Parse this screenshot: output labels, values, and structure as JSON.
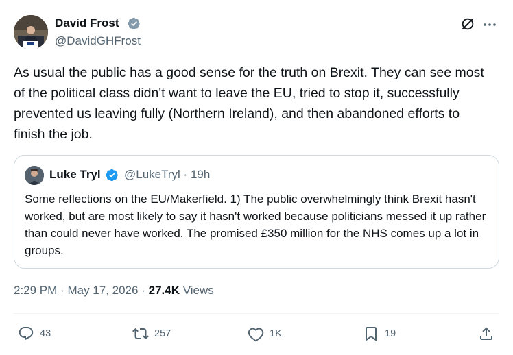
{
  "author": {
    "name": "David Frost",
    "handle": "@DavidGHFrost",
    "verified": true
  },
  "post": {
    "text": "As usual the public has a good sense for the truth on Brexit. They can see most of the political class didn't want to leave the EU, tried to stop it, successfully prevented us leaving fully (Northern Ireland), and then abandoned efforts to finish the job."
  },
  "quote": {
    "name": "Luke Tryl",
    "handle": "@LukeTryl",
    "separator": "·",
    "time": "19h",
    "text": "Some reflections on the EU/Makerfield. 1) The public overwhelmingly think Brexit hasn't worked, but are most likely to say it hasn't worked because politicians messed it up rather than could never have worked. The promised £350 million for the NHS comes up a lot in groups."
  },
  "meta": {
    "time": "2:29 PM",
    "separator": "·",
    "date": "May 17, 2026",
    "separator2": "·",
    "views_count": "27.4K",
    "views_label": "Views"
  },
  "actions": {
    "replies": "43",
    "reposts": "257",
    "likes": "1K",
    "bookmarks": "19"
  },
  "icons": {
    "verified": "verified-badge-icon",
    "grok": "grok-icon",
    "more": "more-icon",
    "reply": "reply-icon",
    "repost": "repost-icon",
    "like": "heart-icon",
    "bookmark": "bookmark-icon",
    "share": "share-icon"
  },
  "colors": {
    "verified": "#1d9bf0",
    "text": "#0f1419",
    "secondary": "#536471",
    "border": "#cfd9de"
  }
}
